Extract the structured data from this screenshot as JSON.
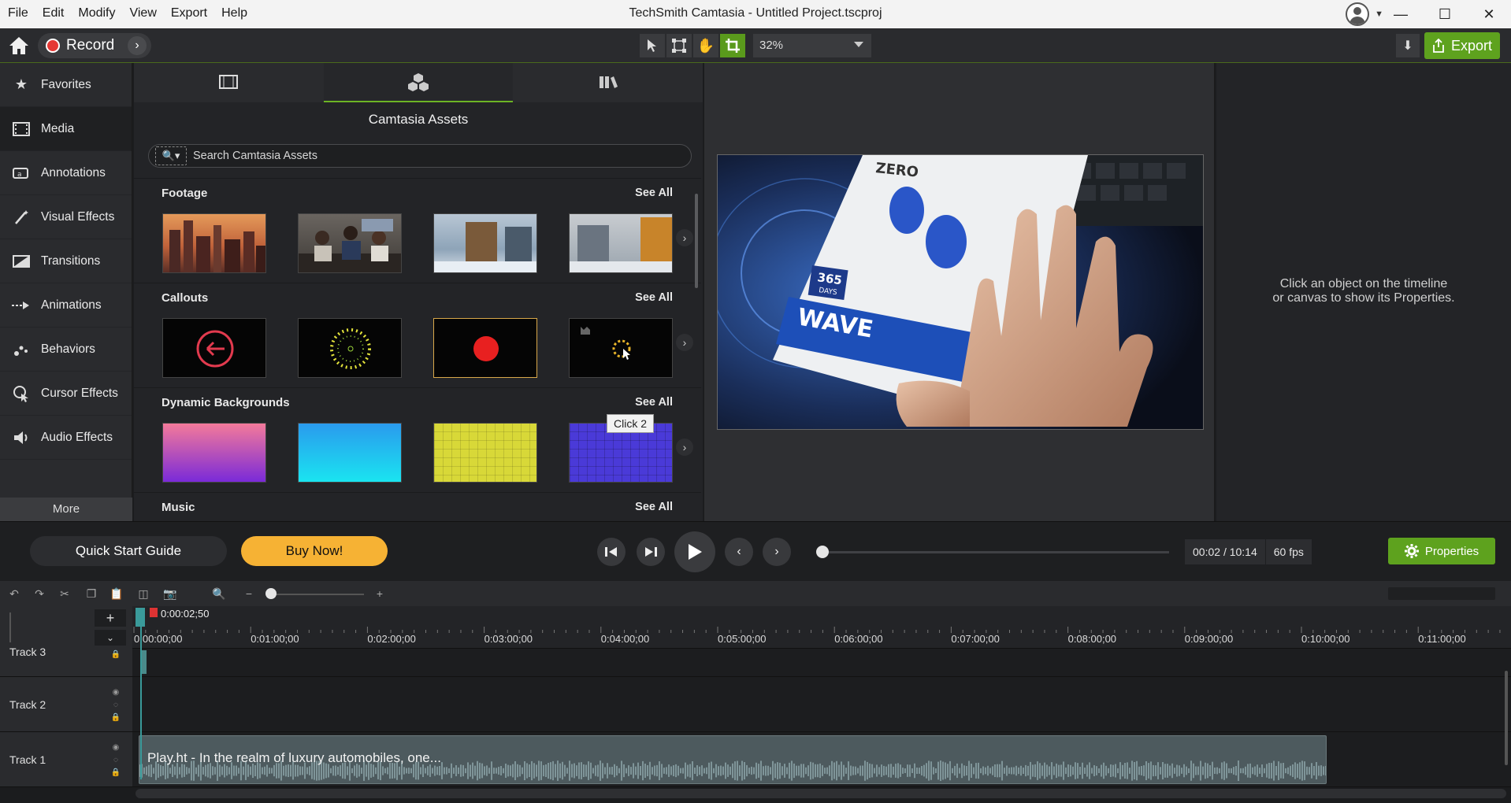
{
  "menu": [
    "File",
    "Edit",
    "Modify",
    "View",
    "Export",
    "Help"
  ],
  "window": {
    "title": "TechSmith Camtasia - Untitled Project.tscproj"
  },
  "toolbar": {
    "record_label": "Record",
    "zoom": "32%",
    "export_label": "Export"
  },
  "sidebar": {
    "items": [
      {
        "label": "Favorites",
        "icon": "star-icon"
      },
      {
        "label": "Media",
        "icon": "film-icon"
      },
      {
        "label": "Annotations",
        "icon": "annotation-icon"
      },
      {
        "label": "Visual Effects",
        "icon": "wand-icon"
      },
      {
        "label": "Transitions",
        "icon": "transition-icon"
      },
      {
        "label": "Animations",
        "icon": "animation-icon"
      },
      {
        "label": "Behaviors",
        "icon": "behaviors-icon"
      },
      {
        "label": "Cursor Effects",
        "icon": "cursor-icon"
      },
      {
        "label": "Audio Effects",
        "icon": "speaker-icon"
      }
    ],
    "more_label": "More"
  },
  "library": {
    "title": "Camtasia Assets",
    "search_placeholder": "Search Camtasia Assets",
    "sections": [
      {
        "title": "Footage",
        "see_all": "See All"
      },
      {
        "title": "Callouts",
        "see_all": "See All"
      },
      {
        "title": "Dynamic Backgrounds",
        "see_all": "See All"
      },
      {
        "title": "Music",
        "see_all": "See All"
      }
    ],
    "tooltip": "Click 2"
  },
  "canvas": {
    "box_brand": "ZERO",
    "box_product": "WAVE",
    "box_badge_number": "365",
    "box_badge_text": "DAYS"
  },
  "properties": {
    "hint_line1": "Click an object on the timeline",
    "hint_line2": "or canvas to show its Properties."
  },
  "playback": {
    "quick_start": "Quick Start Guide",
    "buy_now": "Buy Now!",
    "current_time": "00:02",
    "separator": "/",
    "total_time": "10:14",
    "fps": "60 fps",
    "properties_label": "Properties"
  },
  "timeline": {
    "playhead_time": "0:00:02;50",
    "ticks": [
      "0:00:00;00",
      "0:01:00;00",
      "0:02:00;00",
      "0:03:00;00",
      "0:04:00;00",
      "0:05:00;00",
      "0:06:00;00",
      "0:07:00;00",
      "0:08:00;00",
      "0:09:00;00",
      "0:10:00;00",
      "0:11:00;00"
    ],
    "tracks": [
      {
        "name": "Track 3"
      },
      {
        "name": "Track 2"
      },
      {
        "name": "Track 1"
      }
    ],
    "audio_clip": "Play.ht - In the realm of luxury automobiles, one..."
  }
}
